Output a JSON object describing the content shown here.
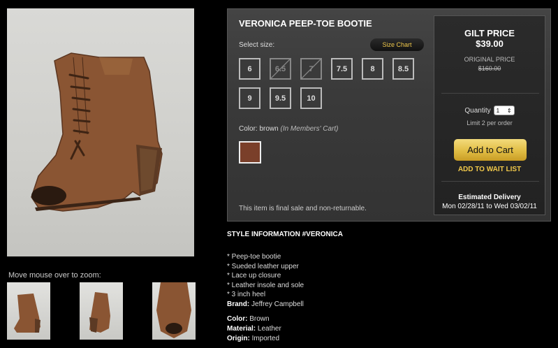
{
  "product": {
    "title": "VERONICA PEEP-TOE BOOTIE"
  },
  "gallery": {
    "zoom_hint": "Move mouse over to zoom:"
  },
  "sizes": {
    "label": "Select size:",
    "size_chart_label": "Size Chart",
    "options": [
      {
        "label": "6",
        "available": true
      },
      {
        "label": "6.5",
        "available": false
      },
      {
        "label": "7",
        "available": false
      },
      {
        "label": "7.5",
        "available": true
      },
      {
        "label": "8",
        "available": true
      },
      {
        "label": "8.5",
        "available": true
      },
      {
        "label": "9",
        "available": true
      },
      {
        "label": "9.5",
        "available": true
      },
      {
        "label": "10",
        "available": true
      }
    ]
  },
  "color": {
    "prefix": "Color: brown",
    "note": "(In Members' Cart)",
    "swatch_hex": "#7a3f2a"
  },
  "final_sale_note": "This item is final sale and non-returnable.",
  "price": {
    "gilt_label": "GILT PRICE",
    "gilt_value": "$39.00",
    "original_label": "ORIGINAL PRICE",
    "original_value": "$160.00"
  },
  "quantity": {
    "label": "Quantity",
    "value": "1",
    "limit": "Limit 2 per order"
  },
  "actions": {
    "add_to_cart": "Add to Cart",
    "wait_list": "ADD TO WAIT LIST"
  },
  "delivery": {
    "label": "Estimated Delivery",
    "dates": "Mon 02/28/11 to Wed 03/02/11"
  },
  "style_info": {
    "heading": "STYLE INFORMATION #VERONICA",
    "features": [
      "* Peep-toe bootie",
      "* Sueded leather upper",
      "* Lace up closure",
      "* Leather insole and sole",
      "* 3 inch heel"
    ],
    "brand_label": "Brand:",
    "brand_value": "Jeffrey Campbell",
    "color_label": "Color:",
    "color_value": "Brown",
    "material_label": "Material:",
    "material_value": "Leather",
    "origin_label": "Origin:",
    "origin_value": "Imported"
  },
  "colors": {
    "accent_gold": "#f0c84a",
    "button_gold": "#e1bd44",
    "panel_bg": "#3a3a3a"
  }
}
